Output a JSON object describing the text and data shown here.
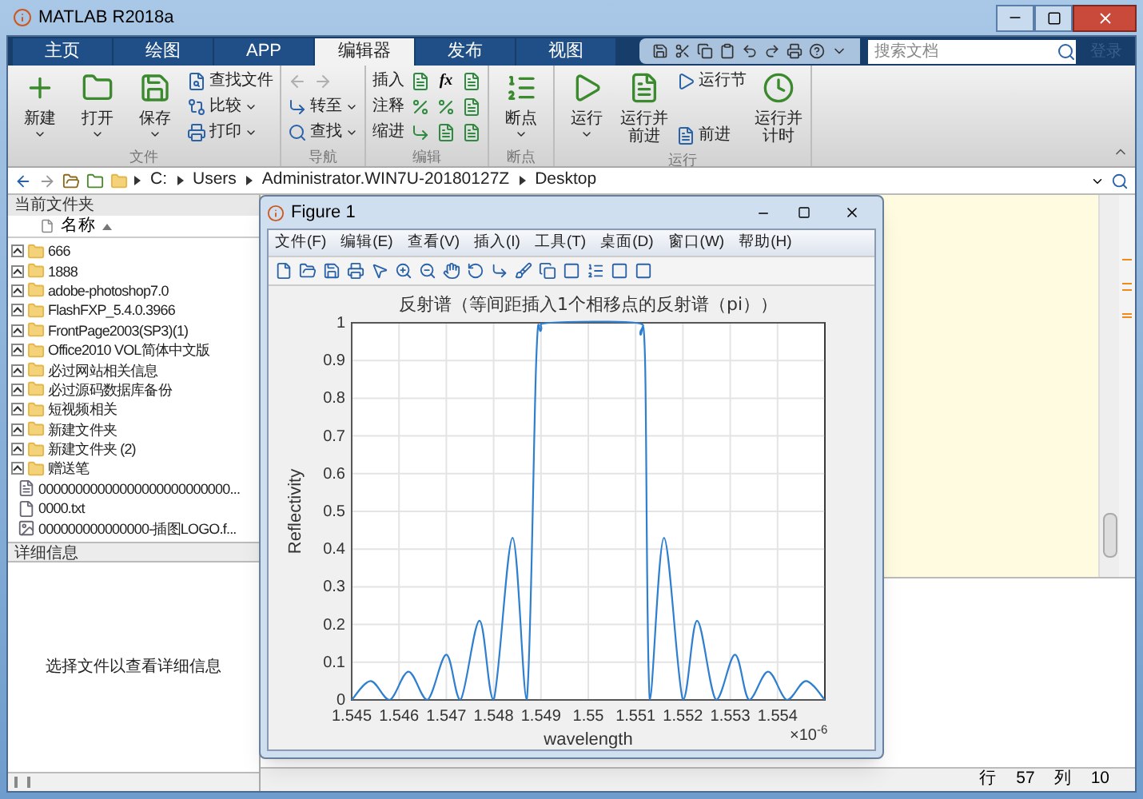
{
  "window": {
    "title": "MATLAB R2018a"
  },
  "tabs": [
    {
      "label": "主页",
      "selected": false
    },
    {
      "label": "绘图",
      "selected": false
    },
    {
      "label": "APP",
      "selected": false
    },
    {
      "label": "编辑器",
      "selected": true
    },
    {
      "label": "发布",
      "selected": false
    },
    {
      "label": "视图",
      "selected": false
    }
  ],
  "search": {
    "placeholder": "搜索文档"
  },
  "sign_in": "登录",
  "ribbon": [
    {
      "label": "文件",
      "columns": [
        [
          {
            "kind": "large",
            "label": "新建",
            "dropdown": true
          }
        ],
        [
          {
            "kind": "large",
            "label": "打开",
            "dropdown": true
          }
        ],
        [
          {
            "kind": "large",
            "label": "保存",
            "dropdown": true
          }
        ],
        [
          {
            "kind": "small",
            "label": "查找文件",
            "dropdown": false
          },
          {
            "kind": "small",
            "label": "比较",
            "dropdown": true
          },
          {
            "kind": "small",
            "label": "打印",
            "dropdown": true
          }
        ]
      ]
    },
    {
      "label": "导航",
      "columns": [
        [
          {
            "kind": "arrows"
          },
          {
            "kind": "small",
            "label": "转至",
            "dropdown": true
          },
          {
            "kind": "small",
            "label": "查找",
            "dropdown": true
          }
        ]
      ]
    },
    {
      "label": "编辑",
      "columns": [
        [
          {
            "kind": "text",
            "label": "插入"
          },
          {
            "kind": "text",
            "label": "注释"
          },
          {
            "kind": "text",
            "label": "缩进"
          }
        ],
        [
          {
            "kind": "icon"
          },
          {
            "kind": "icon"
          },
          {
            "kind": "icon"
          }
        ],
        [
          {
            "kind": "fx",
            "label": "fx"
          },
          {
            "kind": "icon"
          },
          {
            "kind": "icon"
          }
        ],
        [
          {
            "kind": "icon"
          },
          {
            "kind": "icon"
          },
          {
            "kind": "icon"
          }
        ]
      ]
    },
    {
      "label": "断点",
      "columns": [
        [
          {
            "kind": "large",
            "label": "断点",
            "dropdown": true
          }
        ]
      ]
    },
    {
      "label": "运行",
      "columns": [
        [
          {
            "kind": "large",
            "label": "运行",
            "dropdown": true
          }
        ],
        [
          {
            "kind": "large",
            "label": "运行并前进",
            "dropdown": false
          }
        ],
        [
          {
            "kind": "small",
            "label": "运行节",
            "dropdown": false
          },
          {
            "kind": "small",
            "label": "前进",
            "dropdown": false
          }
        ],
        [
          {
            "kind": "large",
            "label": "运行并计时",
            "dropdown": false
          }
        ]
      ]
    }
  ],
  "address": [
    "C:",
    "Users",
    "Administrator.WIN7U-20180127Z",
    "Desktop"
  ],
  "current_folder": {
    "title": "当前文件夹",
    "column": "名称",
    "items": [
      {
        "kind": "folder",
        "name": "666",
        "expanded": false
      },
      {
        "kind": "folder",
        "name": "1888",
        "expanded": false
      },
      {
        "kind": "folder",
        "name": "adobe-photoshop7.0",
        "expanded": false
      },
      {
        "kind": "folder",
        "name": "FlashFXP_5.4.0.3966",
        "expanded": false
      },
      {
        "kind": "folder",
        "name": "FrontPage2003(SP3)(1)",
        "expanded": false
      },
      {
        "kind": "folder",
        "name": "Office2010 VOL简体中文版",
        "expanded": false
      },
      {
        "kind": "folder",
        "name": "必过网站相关信息",
        "expanded": false
      },
      {
        "kind": "folder",
        "name": "必过源码数据库备份",
        "expanded": false
      },
      {
        "kind": "folder",
        "name": "短视频相关",
        "expanded": false
      },
      {
        "kind": "folder",
        "name": "新建文件夹",
        "expanded": false
      },
      {
        "kind": "folder",
        "name": "新建文件夹 (2)",
        "expanded": false
      },
      {
        "kind": "folder",
        "name": "赠送笔",
        "expanded": false
      },
      {
        "kind": "document",
        "name": "00000000000000000000000000..."
      },
      {
        "kind": "text",
        "name": "0000.txt"
      },
      {
        "kind": "image",
        "name": "000000000000000-插图LOGO.f..."
      }
    ]
  },
  "details": {
    "title": "详细信息",
    "message": "选择文件以查看详细信息"
  },
  "figure": {
    "title": "Figure 1",
    "menu": [
      "文件(F)",
      "编辑(E)",
      "查看(V)",
      "插入(I)",
      "工具(T)",
      "桌面(D)",
      "窗口(W)",
      "帮助(H)"
    ],
    "x_multiplier": "×10$^{-6}$",
    "chart_data": {
      "type": "line",
      "title": "反射谱（等间距插入1个相移点的反射谱（pi））",
      "xlabel": "wavelength",
      "ylabel": "Reflectivity",
      "x": [
        1.545,
        1.5454,
        1.5458,
        1.5462,
        1.5466,
        1.547,
        1.5473,
        1.5477,
        1.548,
        1.5484,
        1.5487,
        1.5489,
        1.549,
        1.5492,
        1.551,
        1.5511,
        1.5512,
        1.5513,
        1.5516,
        1.552,
        1.5523,
        1.5527,
        1.5531,
        1.5534,
        1.5538,
        1.5542,
        1.5546,
        1.555
      ],
      "grid": true,
      "series": [
        {
          "color": "#2f7fd0",
          "values": [
            0,
            0.05,
            0,
            0.075,
            0,
            0.12,
            0,
            0.21,
            0,
            0.43,
            0,
            0.9,
            0.98,
            1,
            1,
            0.97,
            0.9,
            0,
            0.43,
            0,
            0.21,
            0,
            0.12,
            0,
            0.075,
            0,
            0.05,
            0
          ]
        }
      ],
      "xlim": [
        1.545,
        1.555
      ],
      "ylim": [
        0,
        1
      ],
      "xticks": [
        1.545,
        1.546,
        1.547,
        1.548,
        1.549,
        {
          "value": 1.55,
          "label": "1.55"
        },
        1.551,
        1.552,
        1.553,
        1.554
      ],
      "yticks": [
        0,
        0.1,
        0.2,
        0.3,
        0.4,
        0.5,
        0.6,
        0.7,
        0.8,
        0.9,
        1
      ]
    }
  },
  "status": {
    "row_label": "行",
    "row": "57",
    "col_label": "列",
    "col": "10"
  }
}
